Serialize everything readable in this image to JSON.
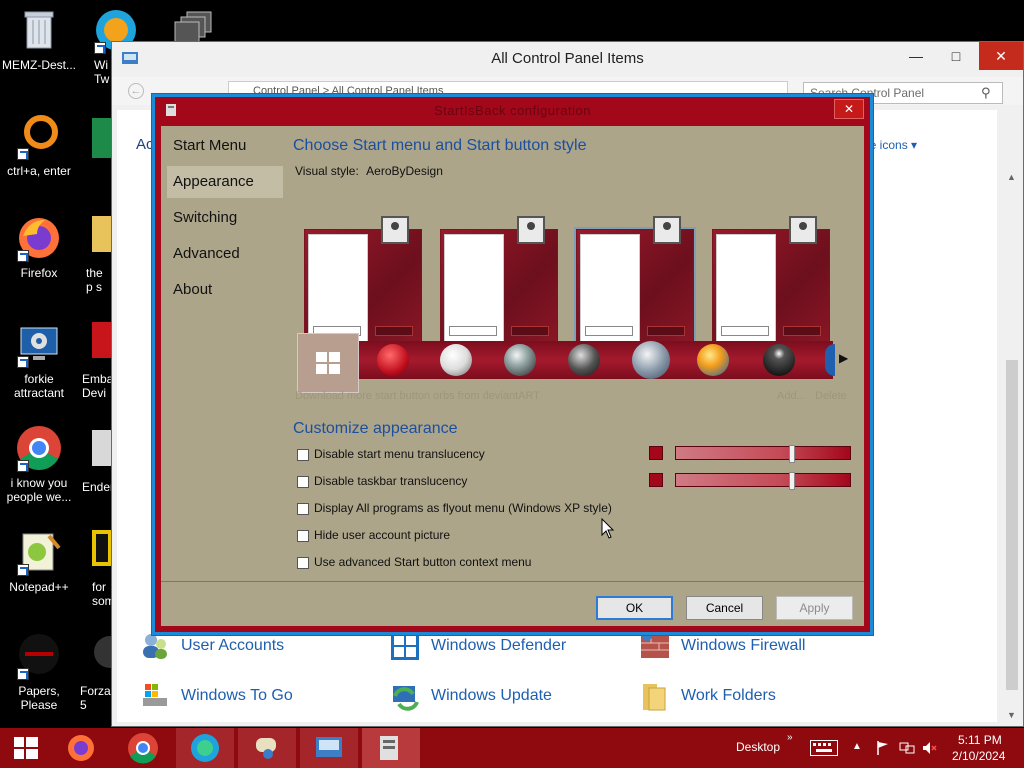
{
  "desktop": {
    "icons": [
      {
        "label": "MEMZ-Dest...",
        "icon": "recycle-bin-icon"
      },
      {
        "label": "ctrl+a, enter",
        "icon": "orange-ring-icon"
      },
      {
        "label": "Firefox",
        "icon": "firefox-icon"
      },
      {
        "label": "forkie attractant",
        "icon": "settings-monitor-icon"
      },
      {
        "label": "i know you people we...",
        "icon": "chrome-icon"
      },
      {
        "label": "Notepad++",
        "icon": "notepadpp-icon"
      },
      {
        "label": "Papers, Please",
        "icon": "papers-please-icon"
      },
      {
        "label": "Wi Tw",
        "icon": "edge-icon"
      },
      {
        "label": "the p s",
        "icon": "folder-icon"
      },
      {
        "label": "Emba Devi",
        "icon": "embarcadero-icon"
      },
      {
        "label": "Ender",
        "icon": "ender-icon"
      },
      {
        "label": "for some",
        "icon": "black-app-icon"
      },
      {
        "label": "Forza 5",
        "icon": "forza-icon"
      }
    ]
  },
  "control_panel": {
    "title": "All Control Panel Items",
    "search_placeholder": "Search Control Panel",
    "address": "Control Panel > All Control Panel Items",
    "partial_left": "Ac",
    "view_by": "ge icons",
    "items": [
      {
        "label": "User Accounts",
        "icon": "user-accounts-icon"
      },
      {
        "label": "Windows Defender",
        "icon": "windows-defender-icon"
      },
      {
        "label": "Windows Firewall",
        "icon": "windows-firewall-icon"
      },
      {
        "label": "Windows To Go",
        "icon": "windows-to-go-icon"
      },
      {
        "label": "Windows Update",
        "icon": "windows-update-icon"
      },
      {
        "label": "Work Folders",
        "icon": "work-folders-icon"
      }
    ]
  },
  "dialog": {
    "title": "StartIsBack configuration",
    "sidebar": [
      {
        "label": "Start Menu"
      },
      {
        "label": "Appearance"
      },
      {
        "label": "Switching"
      },
      {
        "label": "Advanced"
      },
      {
        "label": "About"
      }
    ],
    "active_tab": "Appearance",
    "heading_style": "Choose Start menu and Start button style",
    "visual_style_label": "Visual style:",
    "visual_style_value": "AeroByDesign",
    "selected_style_index": 2,
    "download_link": "Download more start button orbs from deviantART",
    "add_link": "Add...",
    "delete_link": "Delete",
    "heading_customize": "Customize appearance",
    "options": [
      {
        "label": "Disable start menu translucency",
        "checked": false
      },
      {
        "label": "Disable taskbar translucency",
        "checked": false
      },
      {
        "label": "Display All programs as flyout menu (Windows XP style)",
        "checked": false
      },
      {
        "label": "Hide user account picture",
        "checked": false
      },
      {
        "label": "Use advanced Start button context menu",
        "checked": false
      }
    ],
    "translucency_color": "#a3071a",
    "sliders": [
      {
        "name": "start-menu-translucency",
        "value": 0.67
      },
      {
        "name": "taskbar-translucency",
        "value": 0.67
      }
    ],
    "buttons": {
      "ok": "OK",
      "cancel": "Cancel",
      "apply": "Apply"
    }
  },
  "taskbar": {
    "desktop_label": "Desktop",
    "time": "5:11 PM",
    "date": "2/10/2024",
    "color": "#8e0a0f"
  }
}
